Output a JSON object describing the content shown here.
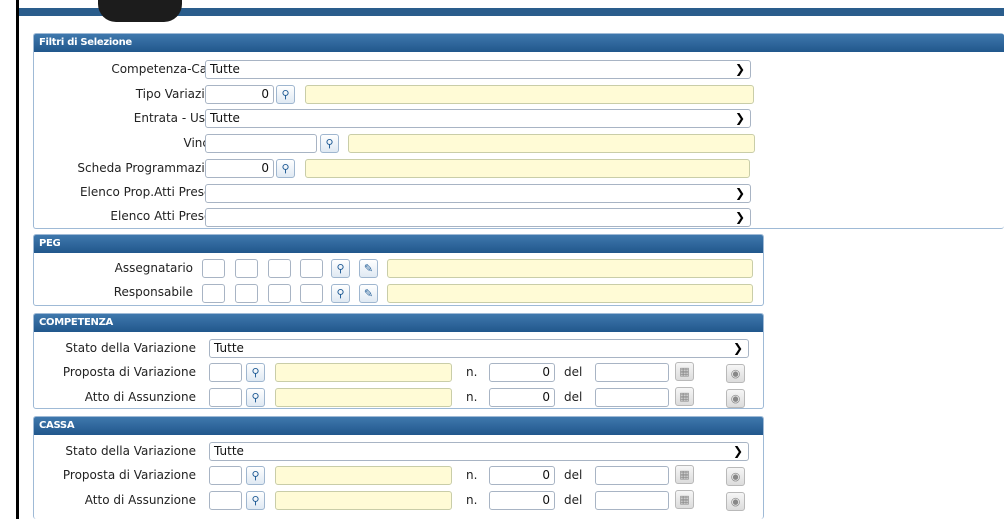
{
  "filtri": {
    "header": "Filtri di Selezione",
    "competenza_cassa": {
      "label": "Competenza-Cassa",
      "value": "Tutte"
    },
    "tipo_variazione": {
      "label": "Tipo Variazione",
      "value": "0"
    },
    "entrata_uscita": {
      "label": "Entrata - Uscita",
      "value": "Tutte"
    },
    "vincolo": {
      "label": "Vincolo",
      "value": ""
    },
    "scheda_programmazione": {
      "label": "Scheda Programmazione",
      "value": "0"
    },
    "elenco_prop_atti": {
      "label": "Elenco Prop.Atti Presenti",
      "value": ""
    },
    "elenco_atti": {
      "label": "Elenco Atti Presenti",
      "value": ""
    }
  },
  "peg": {
    "header": "PEG",
    "assegnatario": {
      "label": "Assegnatario"
    },
    "responsabile": {
      "label": "Responsabile"
    }
  },
  "competenza": {
    "header": "COMPETENZA",
    "stato": {
      "label": "Stato della Variazione",
      "value": "Tutte"
    },
    "proposta": {
      "label": "Proposta di Variazione",
      "n_label": "n.",
      "n_value": "0",
      "del_label": "del"
    },
    "atto": {
      "label": "Atto di Assunzione",
      "n_label": "n.",
      "n_value": "0",
      "del_label": "del"
    }
  },
  "cassa": {
    "header": "CASSA",
    "stato": {
      "label": "Stato della Variazione",
      "value": "Tutte"
    },
    "proposta": {
      "label": "Proposta di Variazione",
      "n_label": "n.",
      "n_value": "0",
      "del_label": "del"
    },
    "atto": {
      "label": "Atto di Assunzione",
      "n_label": "n.",
      "n_value": "0",
      "del_label": "del"
    }
  },
  "icons": {
    "search": "🔍",
    "edit": "✎",
    "calendar": "▦",
    "eye": "◉",
    "chevron": "⌄"
  }
}
